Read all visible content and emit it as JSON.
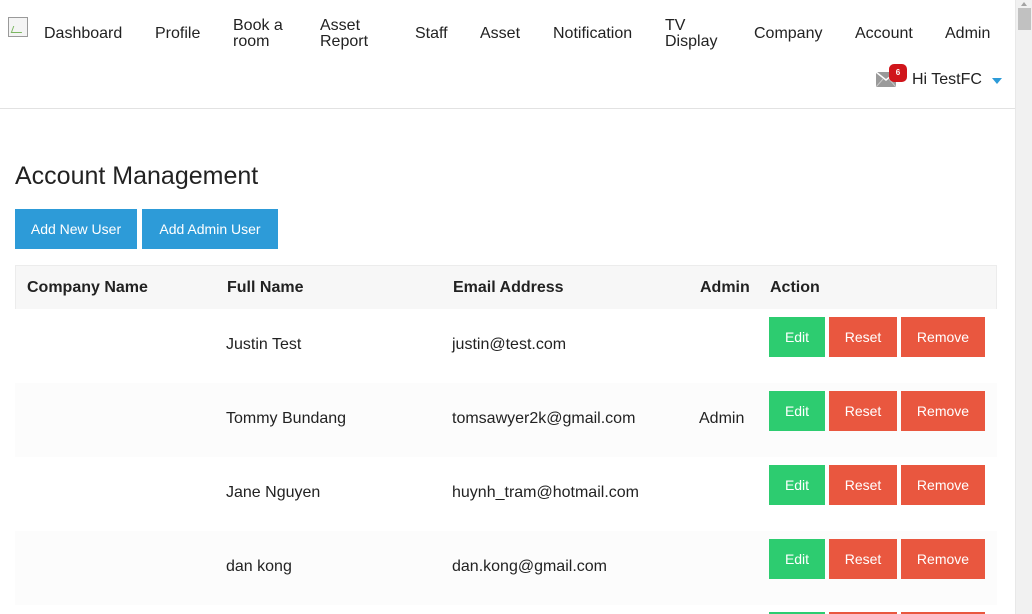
{
  "nav": {
    "items": [
      {
        "label": "Dashboard"
      },
      {
        "label": "Profile"
      },
      {
        "label": "Book a room"
      },
      {
        "label": "Asset Report"
      },
      {
        "label": "Staff"
      },
      {
        "label": "Asset"
      },
      {
        "label": "Notification"
      },
      {
        "label": "TV Display"
      },
      {
        "label": "Company"
      },
      {
        "label": "Account"
      },
      {
        "label": "Admin"
      }
    ]
  },
  "user": {
    "greeting": "Hi TestFC",
    "unread_count": "6"
  },
  "page": {
    "title": "Account Management",
    "add_user_label": "Add New User",
    "add_admin_label": "Add Admin User"
  },
  "table": {
    "headers": [
      "Company Name",
      "Full Name",
      "Email Address",
      "Admin",
      "Action"
    ],
    "rows": [
      {
        "company": "",
        "name": "Justin Test",
        "email": "justin@test.com",
        "admin": "",
        "edit": "Edit",
        "reset": "Reset",
        "remove": "Remove"
      },
      {
        "company": "",
        "name": "Tommy Bundang",
        "email": "tomsawyer2k@gmail.com",
        "admin": "Admin",
        "edit": "Edit",
        "reset": "Reset",
        "remove": "Remove"
      },
      {
        "company": "",
        "name": "Jane Nguyen",
        "email": "huynh_tram@hotmail.com",
        "admin": "",
        "edit": "Edit",
        "reset": "Reset",
        "remove": "Remove"
      },
      {
        "company": "",
        "name": "dan kong",
        "email": "dan.kong@gmail.com",
        "admin": "",
        "edit": "Edit",
        "reset": "Reset",
        "remove": "Remove"
      }
    ]
  },
  "colors": {
    "primary": "#2d9bd8",
    "success": "#2dcc70",
    "danger": "#e9573f",
    "badge": "#d0151b"
  }
}
